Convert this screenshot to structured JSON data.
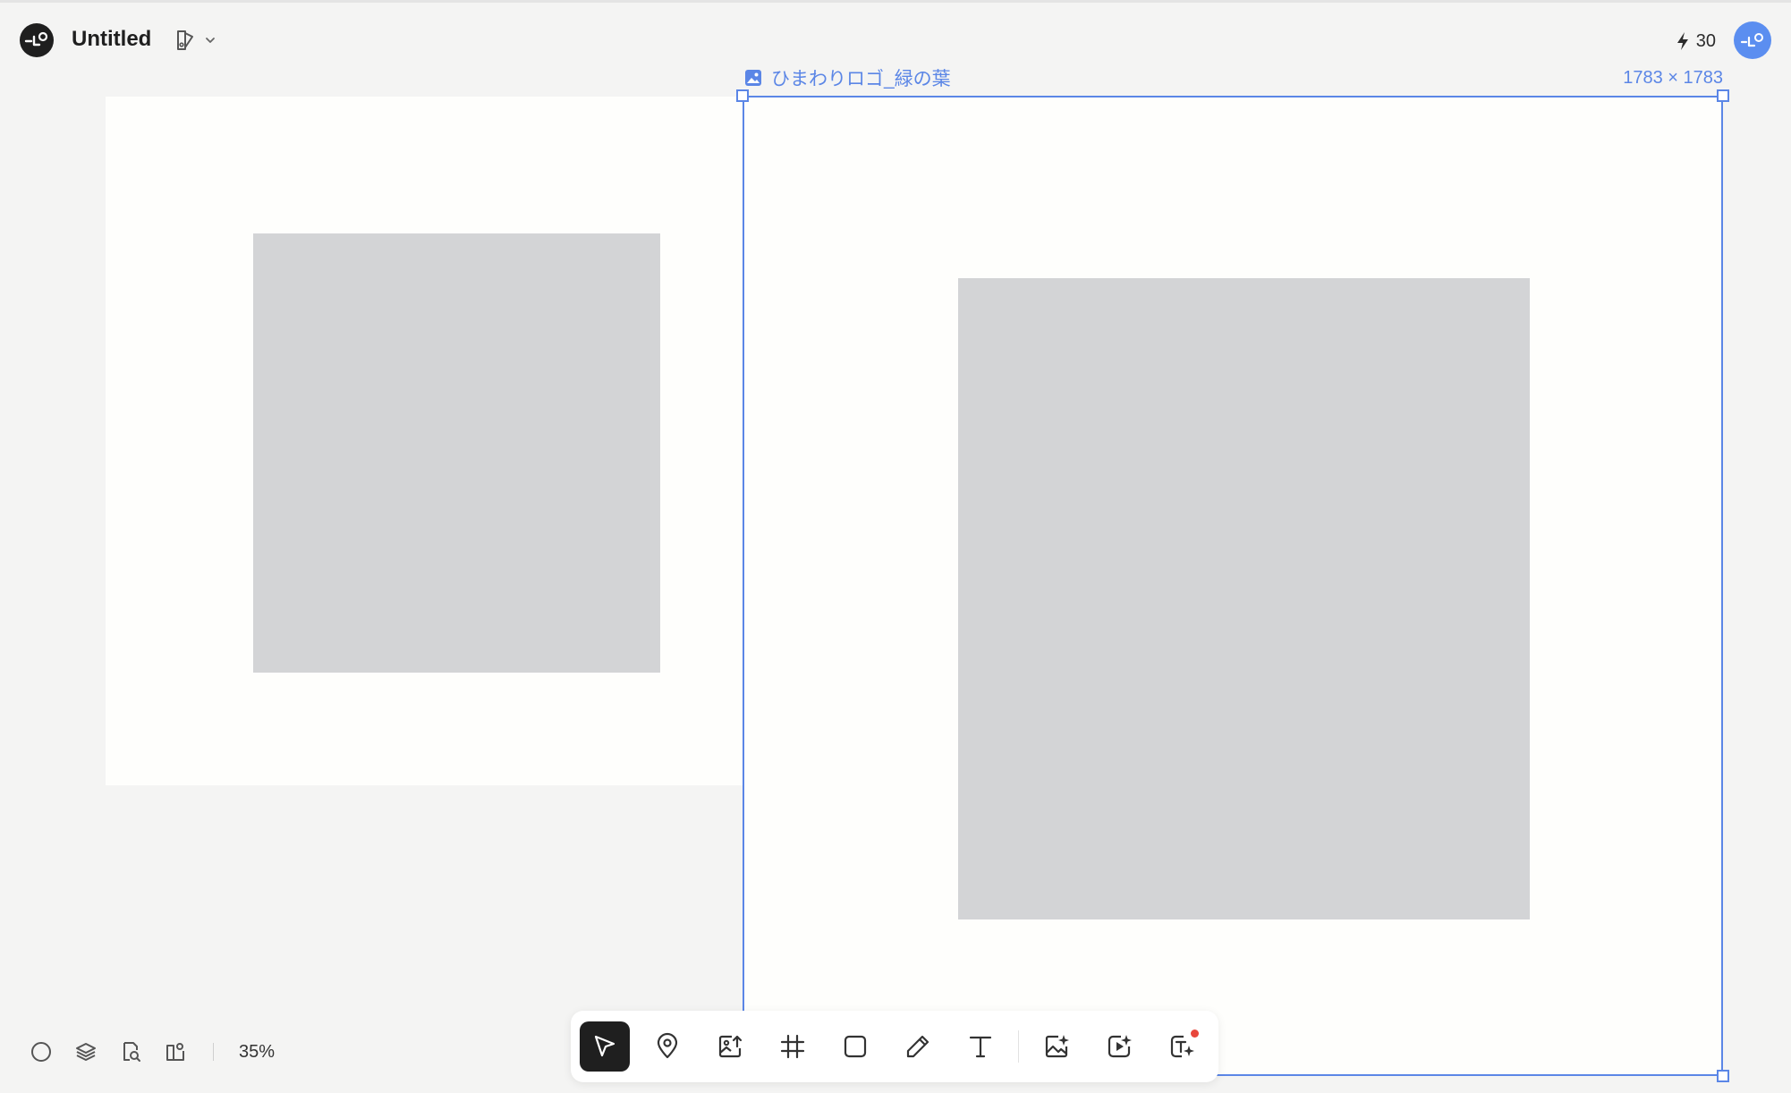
{
  "header": {
    "title": "Untitled",
    "credits": "30"
  },
  "selection": {
    "layer_name": "ひまわりロゴ_緑の葉",
    "dimensions": "1783 × 1783"
  },
  "status": {
    "zoom": "35%"
  },
  "colors": {
    "accent": "#5b86e6",
    "placeholder": "#d3d4d6",
    "canvas": "#f4f4f3",
    "active_tool": "#1f1f1f",
    "notification": "#e8463b"
  },
  "toolbar": {
    "tools": [
      "select",
      "marker",
      "image-upload",
      "frame",
      "rectangle",
      "pen",
      "text",
      "ai-image",
      "ai-video",
      "ai-text"
    ],
    "active": "select"
  }
}
